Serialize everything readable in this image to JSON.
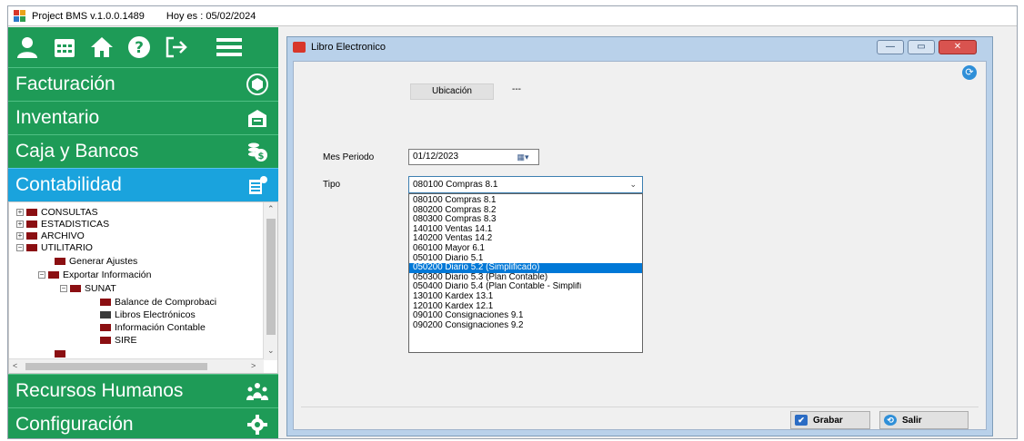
{
  "app": {
    "title": "Project BMS v.1.0.0.1489",
    "date_text": "Hoy es : 05/02/2024"
  },
  "sidebar": {
    "menus": [
      {
        "label": "Facturación",
        "icon": "cube-icon"
      },
      {
        "label": "Inventario",
        "icon": "warehouse-icon"
      },
      {
        "label": "Caja y Bancos",
        "icon": "coins-icon"
      },
      {
        "label": "Contabilidad",
        "icon": "ledger-icon",
        "active": true
      },
      {
        "label": "Recursos Humanos",
        "icon": "people-icon"
      },
      {
        "label": "Configuración",
        "icon": "gear-icon"
      }
    ],
    "tree": [
      "CONSULTAS",
      "ESTADISTICAS",
      "ARCHIVO",
      "UTILITARIO",
      "Generar Ajustes",
      "Exportar Información",
      "SUNAT",
      "Balance de Comprobaci",
      "Libros Electrónicos",
      "Información Contable",
      "SIRE"
    ]
  },
  "window": {
    "title": "Libro Electronico",
    "ubicacion_label": "Ubicación",
    "ubicacion_value": "---",
    "mes_periodo_label": "Mes Periodo",
    "mes_periodo_value": "01/12/2023",
    "tipo_label": "Tipo",
    "tipo_value": "080100 Compras 8.1",
    "options": [
      "080100 Compras 8.1",
      "080200 Compras 8.2",
      "080300 Compras 8.3",
      "140100 Ventas 14.1",
      "140200 Ventas 14.2",
      "060100 Mayor 6.1",
      "050100 Diario 5.1",
      "050200 Diario 5.2 (Simplificado)",
      "050300 Diario 5.3 (Plan Contable)",
      "050400 Diario 5.4 (Plan Contable - Simplifi",
      "130100 Kardex 13.1",
      "120100 Kardex 12.1",
      "090100 Consignaciones 9.1",
      "090200 Consignaciones 9.2"
    ],
    "selected_option_index": 7,
    "save_label": "Grabar",
    "exit_label": "Salir"
  },
  "colors": {
    "sidebar_green": "#1e9b57",
    "sidebar_active": "#1aa3dd",
    "selection_blue": "#0078d7"
  }
}
